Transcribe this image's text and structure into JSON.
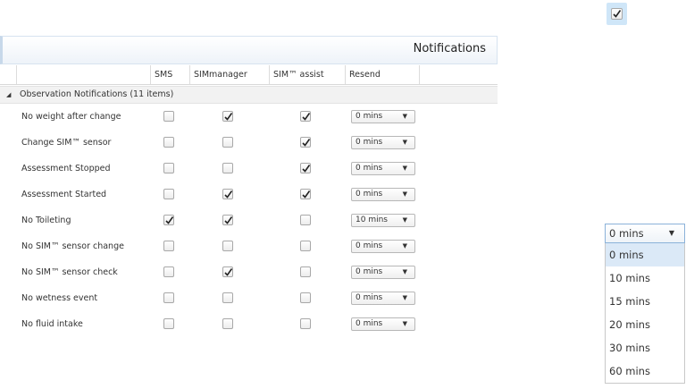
{
  "sample_checkbox": {
    "checked": true
  },
  "header": {
    "title": "Notifications"
  },
  "columns": [
    "SMS",
    "SIMmanager",
    "SIM™ assist",
    "Resend"
  ],
  "group": {
    "label": "Observation Notifications (11 items)"
  },
  "rows": [
    {
      "name": "No weight after change",
      "sms": false,
      "sim": true,
      "assist": true,
      "resend": "0 mins"
    },
    {
      "name": "Change SIM™ sensor",
      "sms": false,
      "sim": false,
      "assist": true,
      "resend": "0 mins"
    },
    {
      "name": "Assessment Stopped",
      "sms": false,
      "sim": false,
      "assist": true,
      "resend": "0 mins"
    },
    {
      "name": "Assessment Started",
      "sms": false,
      "sim": true,
      "assist": true,
      "resend": "0 mins"
    },
    {
      "name": "No Toileting",
      "sms": true,
      "sim": true,
      "assist": false,
      "resend": "10 mins"
    },
    {
      "name": "No SIM™ sensor change",
      "sms": false,
      "sim": false,
      "assist": false,
      "resend": "0 mins"
    },
    {
      "name": "No SIM™ sensor check",
      "sms": false,
      "sim": true,
      "assist": false,
      "resend": "0 mins"
    },
    {
      "name": "No wetness event",
      "sms": false,
      "sim": false,
      "assist": false,
      "resend": "0 mins"
    },
    {
      "name": "No fluid intake",
      "sms": false,
      "sim": false,
      "assist": false,
      "resend": "0 mins"
    }
  ],
  "dropdown": {
    "selected": "0 mins",
    "options": [
      "0 mins",
      "10 mins",
      "15 mins",
      "20 mins",
      "30 mins",
      "60 mins"
    ]
  }
}
